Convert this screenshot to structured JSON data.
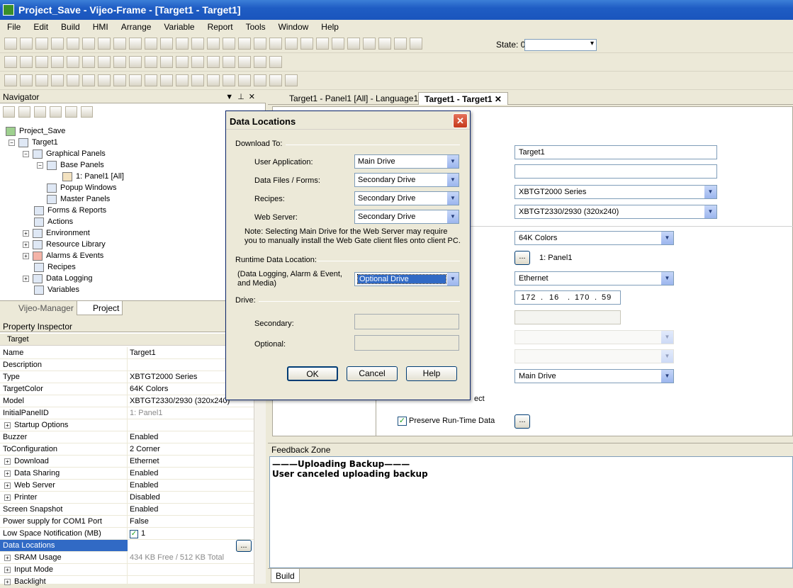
{
  "window": {
    "title": "Project_Save - Vijeo-Frame - [Target1 - Target1]"
  },
  "menu": [
    "File",
    "Edit",
    "Build",
    "HMI",
    "Arrange",
    "Variable",
    "Report",
    "Tools",
    "Window",
    "Help"
  ],
  "toolbar": {
    "state_label": "State: 0"
  },
  "navigator": {
    "title": "Navigator",
    "tree": [
      {
        "label": "Project_Save"
      },
      {
        "label": "Target1"
      },
      {
        "label": "Graphical Panels"
      },
      {
        "label": "Base Panels"
      },
      {
        "label": "1: Panel1 [All]"
      },
      {
        "label": "Popup Windows"
      },
      {
        "label": "Master Panels"
      },
      {
        "label": "Forms & Reports"
      },
      {
        "label": "Actions"
      },
      {
        "label": "Environment"
      },
      {
        "label": "Resource Library"
      },
      {
        "label": "Alarms & Events"
      },
      {
        "label": "Recipes"
      },
      {
        "label": "Data Logging"
      },
      {
        "label": "Variables"
      }
    ],
    "tabs": [
      "Vijeo-Manager",
      "Project"
    ]
  },
  "property_inspector": {
    "title": "Property Inspector",
    "target": "Target",
    "rows": [
      {
        "name": "Name",
        "value": "Target1"
      },
      {
        "name": "Description",
        "value": ""
      },
      {
        "name": "Type",
        "value": "XBTGT2000 Series"
      },
      {
        "name": "TargetColor",
        "value": "64K Colors"
      },
      {
        "name": "Model",
        "value": "XBTGT2330/2930 (320x240)"
      },
      {
        "name": "InitialPanelID",
        "value": "1: Panel1"
      },
      {
        "name": "Startup Options",
        "value": ""
      },
      {
        "name": "Buzzer",
        "value": "Enabled"
      },
      {
        "name": "ToConfiguration",
        "value": "2 Corner"
      },
      {
        "name": "Download",
        "value": "Ethernet"
      },
      {
        "name": "Data Sharing",
        "value": "Enabled"
      },
      {
        "name": "Web Server",
        "value": "Enabled"
      },
      {
        "name": "Printer",
        "value": "Disabled"
      },
      {
        "name": "Screen Snapshot",
        "value": "Enabled"
      },
      {
        "name": "Power supply for COM1 Port",
        "value": "False"
      },
      {
        "name": "Low Space Notification (MB)",
        "value": "1"
      },
      {
        "name": "Data Locations",
        "value": ""
      },
      {
        "name": "SRAM Usage",
        "value": "434 KB Free / 512 KB Total"
      },
      {
        "name": "Input Mode",
        "value": ""
      },
      {
        "name": "Backlight",
        "value": ""
      }
    ]
  },
  "doc_tabs": [
    "Target1 - Panel1 [All] - Language1",
    "Target1 - Target1"
  ],
  "target_form": {
    "name": "Target1",
    "description": "",
    "type": "XBTGT2000 Series",
    "model": "XBTGT2330/2930 (320x240)",
    "color": "64K Colors",
    "initial_panel": "1: Panel1",
    "download": "Ethernet",
    "ip": [
      "172",
      "16",
      "170",
      "59"
    ],
    "data_location": "Main Drive",
    "checkbox_partial": "ect",
    "preserve_label": "Preserve Run-Time Data",
    "ellipsis": "..."
  },
  "feedback": {
    "title": "Feedback Zone",
    "lines": [
      "———Uploading Backup———",
      "User canceled uploading backup"
    ],
    "tab": "Build"
  },
  "dialog": {
    "title": "Data Locations",
    "download_to": "Download To:",
    "user_app_label": "User Application:",
    "user_app_value": "Main Drive",
    "data_files_label": "Data Files / Forms:",
    "data_files_value": "Secondary Drive",
    "recipes_label": "Recipes:",
    "recipes_value": "Secondary Drive",
    "web_server_label": "Web Server:",
    "web_server_value": "Secondary Drive",
    "note": "Note: Selecting Main Drive for the Web Server may require you to manually install the Web Gate client files onto client PC.",
    "runtime_label": "Runtime Data Location:",
    "runtime_desc": "(Data Logging, Alarm & Event, and Media)",
    "runtime_value": "Optional Drive",
    "drive_label": "Drive:",
    "secondary_label": "Secondary:",
    "optional_label": "Optional:",
    "ok": "OK",
    "cancel": "Cancel",
    "help": "Help"
  }
}
